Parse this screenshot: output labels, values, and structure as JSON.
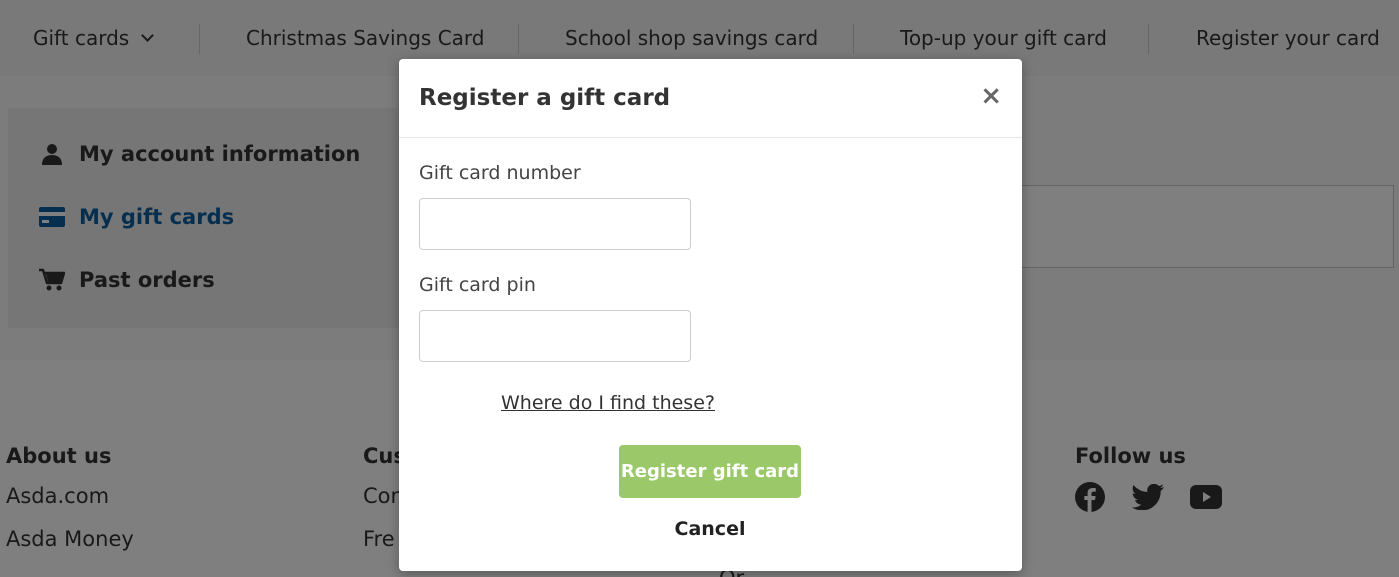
{
  "topnav": {
    "items": [
      {
        "label": "Gift cards"
      },
      {
        "label": "Christmas Savings Card"
      },
      {
        "label": "School shop savings card"
      },
      {
        "label": "Top-up your gift card"
      },
      {
        "label": "Register your card"
      }
    ]
  },
  "sidebar": {
    "items": [
      {
        "label": "My account information",
        "icon": "person-icon"
      },
      {
        "label": "My gift cards",
        "icon": "credit-card-icon"
      },
      {
        "label": "Past orders",
        "icon": "cart-icon"
      }
    ],
    "active_color": "#0d5f9e"
  },
  "footer": {
    "about_heading": "About us",
    "about_links": [
      "Asda.com",
      "Asda Money"
    ],
    "customer_heading_partial": "Cus",
    "customer_links_partial": [
      "Con",
      "Fre"
    ],
    "third_link_partial": "Or",
    "follow_heading": "Follow us",
    "social": [
      "facebook-icon",
      "twitter-icon",
      "youtube-icon"
    ]
  },
  "modal": {
    "title": "Register a gift card",
    "close": "×",
    "card_number_label": "Gift card number",
    "card_number_value": "",
    "card_pin_label": "Gift card pin",
    "card_pin_value": "",
    "help_link": "Where do I find these?",
    "submit_label": "Register gift card",
    "cancel_label": "Cancel",
    "submit_color": "#9bc96a"
  }
}
